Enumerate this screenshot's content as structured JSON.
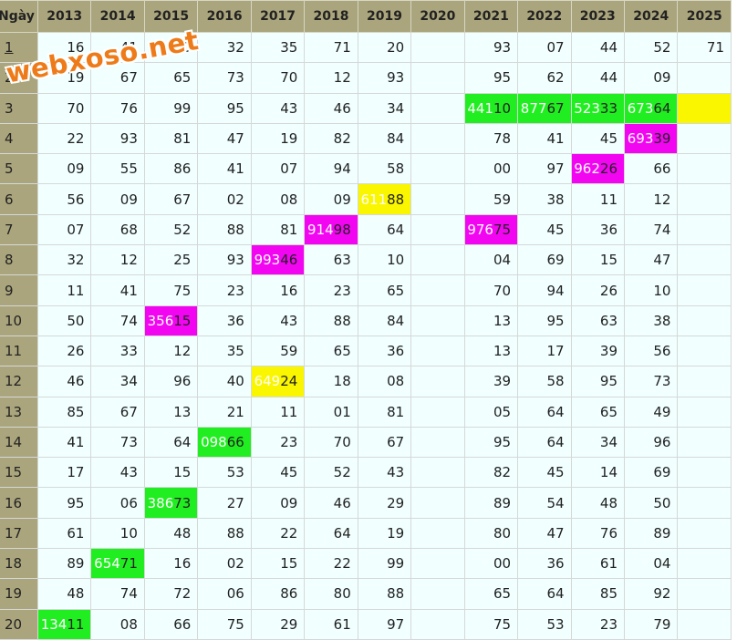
{
  "watermark": "webxoso.net",
  "header": [
    "Ngày",
    "2013",
    "2014",
    "2015",
    "2016",
    "2017",
    "2018",
    "2019",
    "2020",
    "2021",
    "2022",
    "2023",
    "2024",
    "2025"
  ],
  "rows": [
    {
      "day": "1",
      "link": true,
      "cells": [
        "16",
        "41",
        "00",
        "32",
        "35",
        "71",
        "20",
        "",
        "93",
        "07",
        "44",
        "52",
        "71"
      ]
    },
    {
      "day": "2",
      "cells": [
        "19",
        "67",
        "65",
        "73",
        "70",
        "12",
        "93",
        "",
        "95",
        "62",
        "44",
        "09",
        ""
      ]
    },
    {
      "day": "3",
      "cells": [
        "70",
        "76",
        "99",
        "95",
        "43",
        "46",
        "34",
        "",
        "44110",
        "87767",
        "52333",
        "67364",
        ""
      ]
    },
    {
      "day": "4",
      "cells": [
        "22",
        "93",
        "81",
        "47",
        "19",
        "82",
        "84",
        "",
        "78",
        "41",
        "45",
        "69339",
        ""
      ]
    },
    {
      "day": "5",
      "cells": [
        "09",
        "55",
        "86",
        "41",
        "07",
        "94",
        "58",
        "",
        "00",
        "97",
        "96226",
        "66",
        ""
      ]
    },
    {
      "day": "6",
      "cells": [
        "56",
        "09",
        "67",
        "02",
        "08",
        "09",
        "61188",
        "",
        "59",
        "38",
        "11",
        "12",
        ""
      ]
    },
    {
      "day": "7",
      "cells": [
        "07",
        "68",
        "52",
        "88",
        "81",
        "91498",
        "64",
        "",
        "97675",
        "45",
        "36",
        "74",
        ""
      ]
    },
    {
      "day": "8",
      "cells": [
        "32",
        "12",
        "25",
        "93",
        "99346",
        "63",
        "10",
        "",
        "04",
        "69",
        "15",
        "47",
        ""
      ]
    },
    {
      "day": "9",
      "cells": [
        "11",
        "41",
        "75",
        "23",
        "16",
        "23",
        "65",
        "",
        "70",
        "94",
        "26",
        "10",
        ""
      ]
    },
    {
      "day": "10",
      "cells": [
        "50",
        "74",
        "35615",
        "36",
        "43",
        "88",
        "84",
        "",
        "13",
        "95",
        "63",
        "38",
        ""
      ]
    },
    {
      "day": "11",
      "cells": [
        "26",
        "33",
        "12",
        "35",
        "59",
        "65",
        "36",
        "",
        "13",
        "17",
        "39",
        "56",
        ""
      ]
    },
    {
      "day": "12",
      "cells": [
        "46",
        "34",
        "96",
        "40",
        "64924",
        "18",
        "08",
        "",
        "39",
        "58",
        "95",
        "73",
        ""
      ]
    },
    {
      "day": "13",
      "cells": [
        "85",
        "67",
        "13",
        "21",
        "11",
        "01",
        "81",
        "",
        "05",
        "64",
        "65",
        "49",
        ""
      ]
    },
    {
      "day": "14",
      "cells": [
        "41",
        "73",
        "64",
        "09866",
        "23",
        "70",
        "67",
        "",
        "95",
        "64",
        "34",
        "96",
        ""
      ]
    },
    {
      "day": "15",
      "cells": [
        "17",
        "43",
        "15",
        "53",
        "45",
        "52",
        "43",
        "",
        "82",
        "45",
        "14",
        "69",
        ""
      ]
    },
    {
      "day": "16",
      "cells": [
        "95",
        "06",
        "38673",
        "27",
        "09",
        "46",
        "29",
        "",
        "89",
        "54",
        "48",
        "50",
        ""
      ]
    },
    {
      "day": "17",
      "cells": [
        "61",
        "10",
        "48",
        "88",
        "22",
        "64",
        "19",
        "",
        "80",
        "47",
        "76",
        "89",
        ""
      ]
    },
    {
      "day": "18",
      "cells": [
        "89",
        "65471",
        "16",
        "02",
        "15",
        "22",
        "99",
        "",
        "00",
        "36",
        "61",
        "04",
        ""
      ]
    },
    {
      "day": "19",
      "cells": [
        "48",
        "74",
        "72",
        "06",
        "86",
        "80",
        "88",
        "",
        "65",
        "64",
        "85",
        "92",
        ""
      ]
    },
    {
      "day": "20",
      "cells": [
        "13411",
        "08",
        "66",
        "75",
        "29",
        "61",
        "97",
        "",
        "75",
        "53",
        "23",
        "79",
        ""
      ]
    }
  ],
  "highlights": {
    "3-8": "green",
    "3-9": "green",
    "3-10": "green",
    "3-11": "green",
    "3-12": "yellow",
    "4-11": "magenta",
    "5-10": "magenta",
    "6-6": "yellow",
    "7-5": "magenta",
    "7-8": "magenta",
    "8-4": "magenta",
    "10-2": "magenta",
    "12-4": "yellow",
    "14-3": "green",
    "16-2": "green",
    "18-1": "green",
    "20-0": "green"
  },
  "colors": {
    "header": "#aaa57c",
    "cell": "#f1ffff",
    "green": "#21ee21",
    "magenta": "#f206f2",
    "yellow": "#f9f600",
    "watermark": "#ee7b1a"
  }
}
